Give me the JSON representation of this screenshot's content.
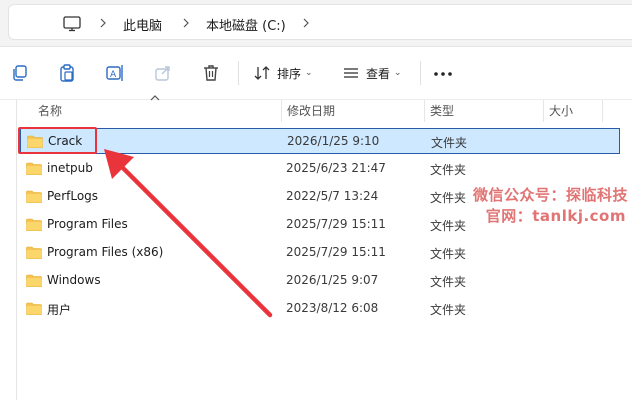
{
  "breadcrumb": {
    "icon": "computer-icon",
    "items": [
      "此电脑",
      "本地磁盘 (C:)"
    ]
  },
  "toolbar": {
    "buttons": [
      {
        "icon": "copy-path-icon"
      },
      {
        "icon": "paste-icon"
      },
      {
        "icon": "rename-icon"
      },
      {
        "icon": "share-icon"
      },
      {
        "icon": "delete-icon"
      }
    ],
    "sort_label": "排序",
    "view_label": "查看",
    "more_icon": "ellipsis-icon"
  },
  "columns": {
    "name": "名称",
    "date": "修改日期",
    "type": "类型",
    "size": "大小"
  },
  "files": [
    {
      "name": "Crack",
      "date": "2026/1/25 9:10",
      "type": "文件夹",
      "selected": true
    },
    {
      "name": "inetpub",
      "date": "2025/6/23 21:47",
      "type": "文件夹"
    },
    {
      "name": "PerfLogs",
      "date": "2022/5/7 13:24",
      "type": "文件夹"
    },
    {
      "name": "Program Files",
      "date": "2025/7/29 15:11",
      "type": "文件夹"
    },
    {
      "name": "Program Files (x86)",
      "date": "2025/7/29 15:11",
      "type": "文件夹"
    },
    {
      "name": "Windows",
      "date": "2026/1/25 9:07",
      "type": "文件夹"
    },
    {
      "name": "用户",
      "date": "2023/8/12 6:08",
      "type": "文件夹"
    }
  ],
  "watermark": {
    "line1": "微信公众号：探临科技",
    "line2": "官网：tanlkj.com"
  },
  "colors": {
    "selection_bg": "#cde8ff",
    "selection_border": "#2a5ba8",
    "annotation": "#e8343a",
    "folder": "#f5c451"
  }
}
